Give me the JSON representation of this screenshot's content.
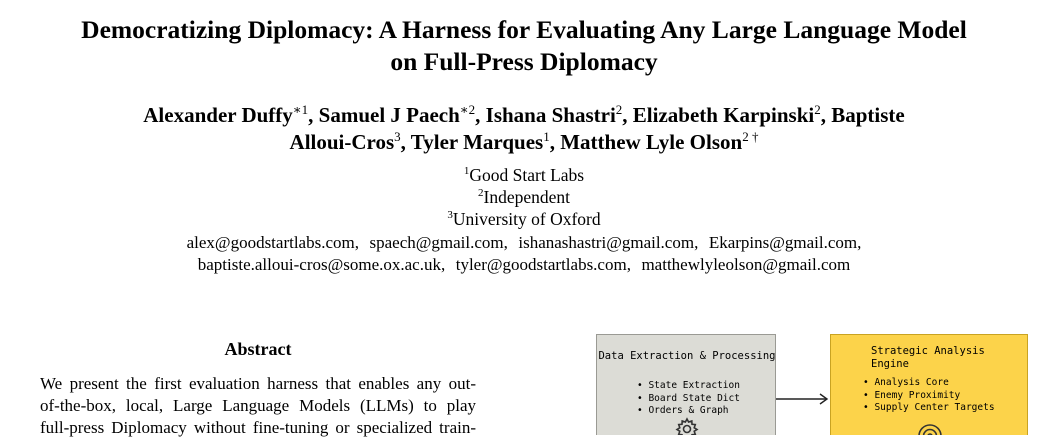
{
  "paper": {
    "title_line1": "Democratizing Diplomacy: A Harness for Evaluating Any Large Language Model",
    "title_line2": "on Full-Press Diplomacy",
    "authors": [
      {
        "name": "Alexander Duffy",
        "sup": "∗1"
      },
      {
        "name": "Samuel J Paech",
        "sup": "∗2"
      },
      {
        "name": "Ishana Shastri",
        "sup": "2"
      },
      {
        "name": "Elizabeth Karpinski",
        "sup": "2"
      },
      {
        "name": "Baptiste Alloui-Cros",
        "sup": "3"
      },
      {
        "name": "Tyler Marques",
        "sup": "1"
      },
      {
        "name": "Matthew Lyle Olson",
        "sup": "2 †"
      }
    ],
    "affiliations": [
      {
        "num": "1",
        "name": "Good Start Labs"
      },
      {
        "num": "2",
        "name": "Independent"
      },
      {
        "num": "3",
        "name": "University of Oxford"
      }
    ],
    "emails_line1": "alex@goodstartlabs.com,  spaech@gmail.com,  ishanashastri@gmail.com,  Ekarpins@gmail.com,",
    "emails_line2": "baptiste.alloui-cros@some.ox.ac.uk,  tyler@goodstartlabs.com,  matthewlyleolson@gmail.com"
  },
  "abstract": {
    "heading": "Abstract",
    "lines": [
      "We present the first evaluation harness that enables any out-",
      "of-the-box, local, Large Language Models (LLMs) to play",
      "full-press Diplomacy without fine-tuning or specialized train-"
    ]
  },
  "figure": {
    "left_box": {
      "title": "Data Extraction & Processing",
      "items": [
        "State Extraction",
        "Board State Dict",
        "Orders & Graph"
      ],
      "color": "#dcdcd6"
    },
    "right_box": {
      "title_line1": "Strategic Analysis",
      "title_line2": "Engine",
      "items": [
        "Analysis Core",
        "Enemy Proximity",
        "Supply Center Targets"
      ],
      "color": "#fcd34a"
    }
  }
}
